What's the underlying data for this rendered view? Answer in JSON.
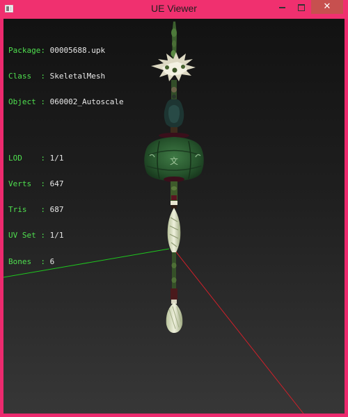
{
  "window": {
    "title": "UE Viewer",
    "controls": {
      "minimize": "—",
      "maximize": "☐",
      "close": "✕"
    },
    "accent_color": "#ef2d6f"
  },
  "mesh_info": {
    "package_key": "Package:",
    "package": "00005688.upk",
    "class_key": "Class  :",
    "class": "SkeletalMesh",
    "object_key": "Object :",
    "object": "060002_Autoscale",
    "lod_key": "LOD    :",
    "lod": "1/1",
    "verts_key": "Verts  :",
    "verts": "647",
    "tris_key": "Tris   :",
    "tris": "687",
    "uvset_key": "UV Set :",
    "uvset": "1/1",
    "bones_key": "Bones  :",
    "bones": "6"
  },
  "scene": {
    "x_axis_color": "#d0202a",
    "z_axis_color": "#1ec81e",
    "mesh_color": "#2e5a2e"
  }
}
